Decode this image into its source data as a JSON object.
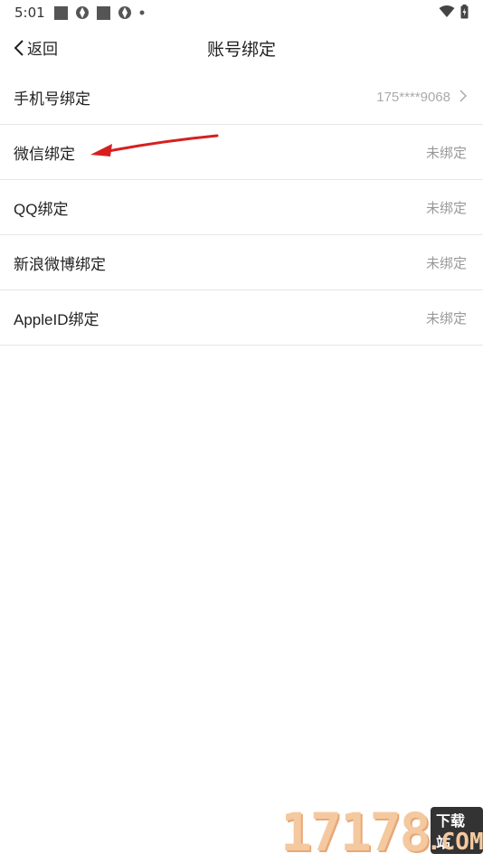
{
  "status_bar": {
    "time": "5:01"
  },
  "header": {
    "back_label": "返回",
    "title": "账号绑定"
  },
  "rows": [
    {
      "label": "手机号绑定",
      "value": "175****9068"
    },
    {
      "label": "微信绑定",
      "value": "未绑定"
    },
    {
      "label": "QQ绑定",
      "value": "未绑定"
    },
    {
      "label": "新浪微博绑定",
      "value": "未绑定"
    },
    {
      "label": "AppleID绑定",
      "value": "未绑定"
    }
  ],
  "watermark": {
    "number": "17178",
    "tag": "下载站",
    "suffix": ".COM"
  },
  "colors": {
    "annotation_arrow": "#d62020",
    "muted_text": "#999999",
    "divider": "#e6e6e6"
  }
}
